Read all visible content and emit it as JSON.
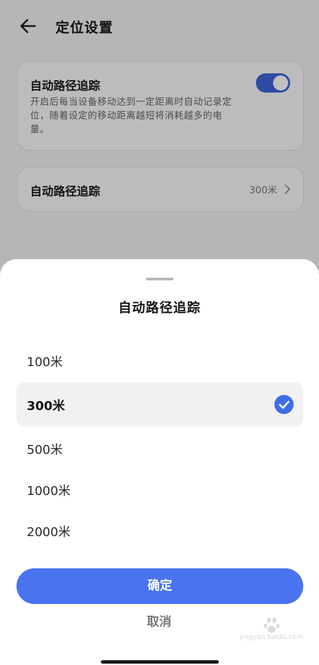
{
  "header": {
    "title": "定位设置",
    "back_icon": "back-arrow-icon"
  },
  "settings": {
    "auto_track_card": {
      "title": "自动路径追踪",
      "description": "开启后每当设备移动达到一定距离时自动记录定位，随着设定的移动距离越短将消耗越多的电量。",
      "toggle_on": true
    },
    "distance_card": {
      "label": "自动路径追踪",
      "value": "300米",
      "chevron_icon": "chevron-right-icon"
    }
  },
  "sheet": {
    "title": "自动路径追踪",
    "options": [
      {
        "label": "100米",
        "selected": false
      },
      {
        "label": "300米",
        "selected": true
      },
      {
        "label": "500米",
        "selected": false
      },
      {
        "label": "1000米",
        "selected": false
      },
      {
        "label": "2000米",
        "selected": false
      }
    ],
    "confirm_label": "确定",
    "cancel_label": "取消"
  },
  "watermark": {
    "text": "jingyan.baidu.com"
  },
  "colors": {
    "accent": "#4a73f0",
    "toggle_on": "#3a66d8",
    "check": "#3f6de6",
    "selected_bg": "#f1f1f1"
  }
}
